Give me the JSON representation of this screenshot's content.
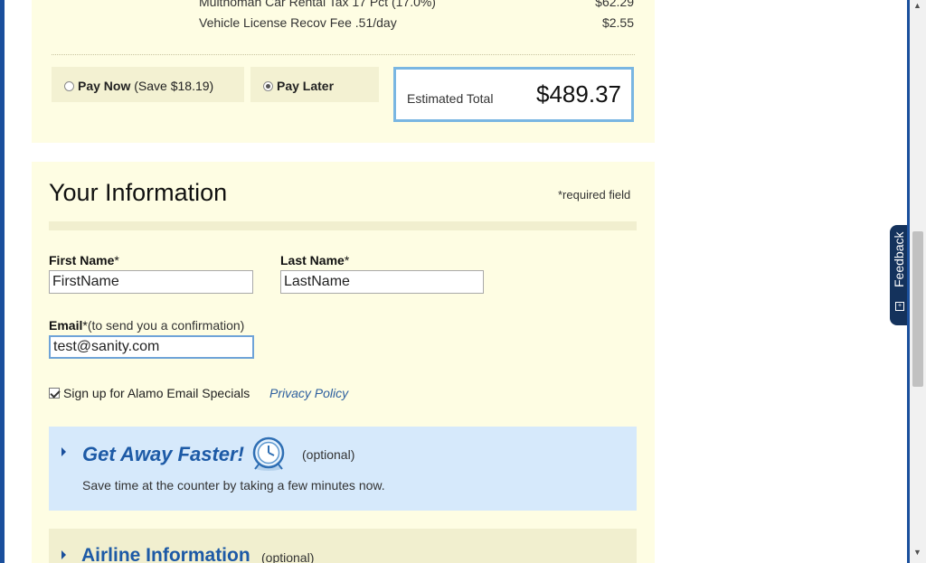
{
  "fees": [
    {
      "label": "Multnomah Car Rental Tax 17 Pct (17.0%)",
      "amount": "$62.29"
    },
    {
      "label": "Vehicle License Recov Fee .51/day",
      "amount": "$2.55"
    }
  ],
  "payment": {
    "pay_now_label": "Pay Now",
    "pay_now_note": "(Save $18.19)",
    "pay_later_label": "Pay Later",
    "selected": "pay_later"
  },
  "estimate": {
    "label": "Estimated Total",
    "total": "$489.37"
  },
  "info": {
    "title": "Your Information",
    "required_note": "*required field",
    "first_name_label": "First Name",
    "last_name_label": "Last Name",
    "email_label": "Email",
    "email_note": "(to send you a confirmation)",
    "asterisk": "*",
    "first_name_value": "FirstName",
    "last_name_value": "LastName",
    "email_value": "test@sanity.com",
    "email_specials_label": "Sign up for Alamo Email Specials",
    "email_specials_checked": true,
    "privacy_link": "Privacy Policy"
  },
  "get_away": {
    "title": "Get Away Faster!",
    "optional": "(optional)",
    "description": "Save time at the counter by taking a few minutes now.",
    "icon": "clock-icon"
  },
  "airline": {
    "title": "Airline Information",
    "optional": "(optional)"
  },
  "feedback": {
    "label": "Feedback"
  },
  "colors": {
    "panel_bg": "#fefde3",
    "accent_blue": "#1d5aa6",
    "frame_blue": "#1a4f9c",
    "estimate_border": "#79b6e2",
    "getaway_bg": "#d6e9fb"
  }
}
